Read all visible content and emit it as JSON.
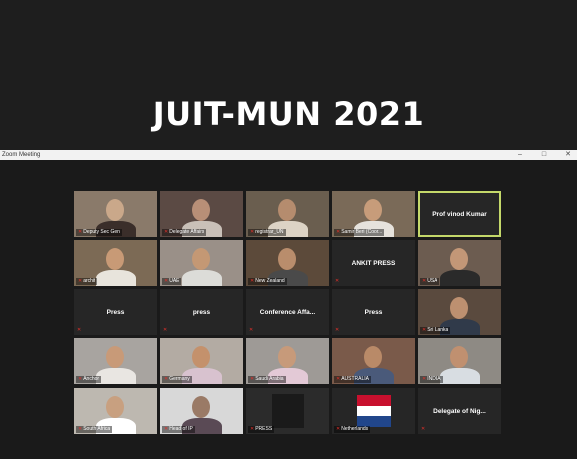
{
  "banner": {
    "title": "JUIT-MUN 2021"
  },
  "window": {
    "title": "Zoom Meeting",
    "controls": [
      {
        "name": "minimize-button",
        "glyph": "–"
      },
      {
        "name": "maximize-button",
        "glyph": "□"
      },
      {
        "name": "close-button",
        "glyph": "✕"
      }
    ]
  },
  "colors": {
    "active_speaker": "#c4d86a",
    "muted_mic": "#e0302a"
  },
  "participants": [
    {
      "label": "Deputy Sec Gen",
      "type": "video",
      "muted": true
    },
    {
      "label": "Delegate Affairs",
      "type": "video",
      "muted": true
    },
    {
      "label": "registrar_UN",
      "type": "video",
      "muted": true
    },
    {
      "label": "Samir Beri (Coor...",
      "type": "video",
      "muted": true
    },
    {
      "label": "Prof vinod Kumar",
      "type": "name",
      "muted": false,
      "active": true
    },
    {
      "label": "archit",
      "type": "video",
      "muted": true
    },
    {
      "label": "UAE",
      "type": "video",
      "muted": true
    },
    {
      "label": "New Zealand",
      "type": "video",
      "muted": true
    },
    {
      "label": "ANKIT PRESS",
      "type": "name",
      "muted": true
    },
    {
      "label": "USA",
      "type": "video",
      "muted": true
    },
    {
      "label": "Press",
      "type": "name",
      "muted": true
    },
    {
      "label": "press",
      "type": "name",
      "muted": true
    },
    {
      "label": "Conference Affa...",
      "type": "name",
      "muted": true
    },
    {
      "label": "Press",
      "type": "name",
      "muted": true
    },
    {
      "label": "Sri Lanka",
      "type": "video",
      "muted": true
    },
    {
      "label": "Anchor",
      "type": "video",
      "muted": true
    },
    {
      "label": "Germany",
      "type": "video",
      "muted": true
    },
    {
      "label": "Saudi Arabia",
      "type": "video",
      "muted": true
    },
    {
      "label": "AUSTRALIA",
      "type": "video",
      "muted": true
    },
    {
      "label": "INDIA",
      "type": "video",
      "muted": true
    },
    {
      "label": "South Africa",
      "type": "video",
      "muted": true
    },
    {
      "label": "Head of IP",
      "type": "video",
      "muted": true
    },
    {
      "label": "PRESS",
      "type": "video",
      "muted": true
    },
    {
      "label": "Netherlands",
      "type": "flag",
      "muted": true,
      "flag_colors": [
        "#c8102e",
        "#ffffff",
        "#21468b"
      ]
    },
    {
      "label": "Delegate of Nig...",
      "type": "name",
      "muted": true
    }
  ]
}
